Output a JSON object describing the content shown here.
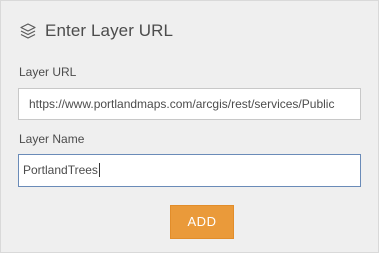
{
  "header": {
    "icon": "layers-icon",
    "title": "Enter Layer URL"
  },
  "form": {
    "url_label": "Layer URL",
    "url_value": "https://www.portlandmaps.com/arcgis/rest/services/Publiс",
    "name_label": "Layer Name",
    "name_value": "PortlandTrees"
  },
  "actions": {
    "add_label": "ADD",
    "add_color": "#ea9a3a"
  }
}
